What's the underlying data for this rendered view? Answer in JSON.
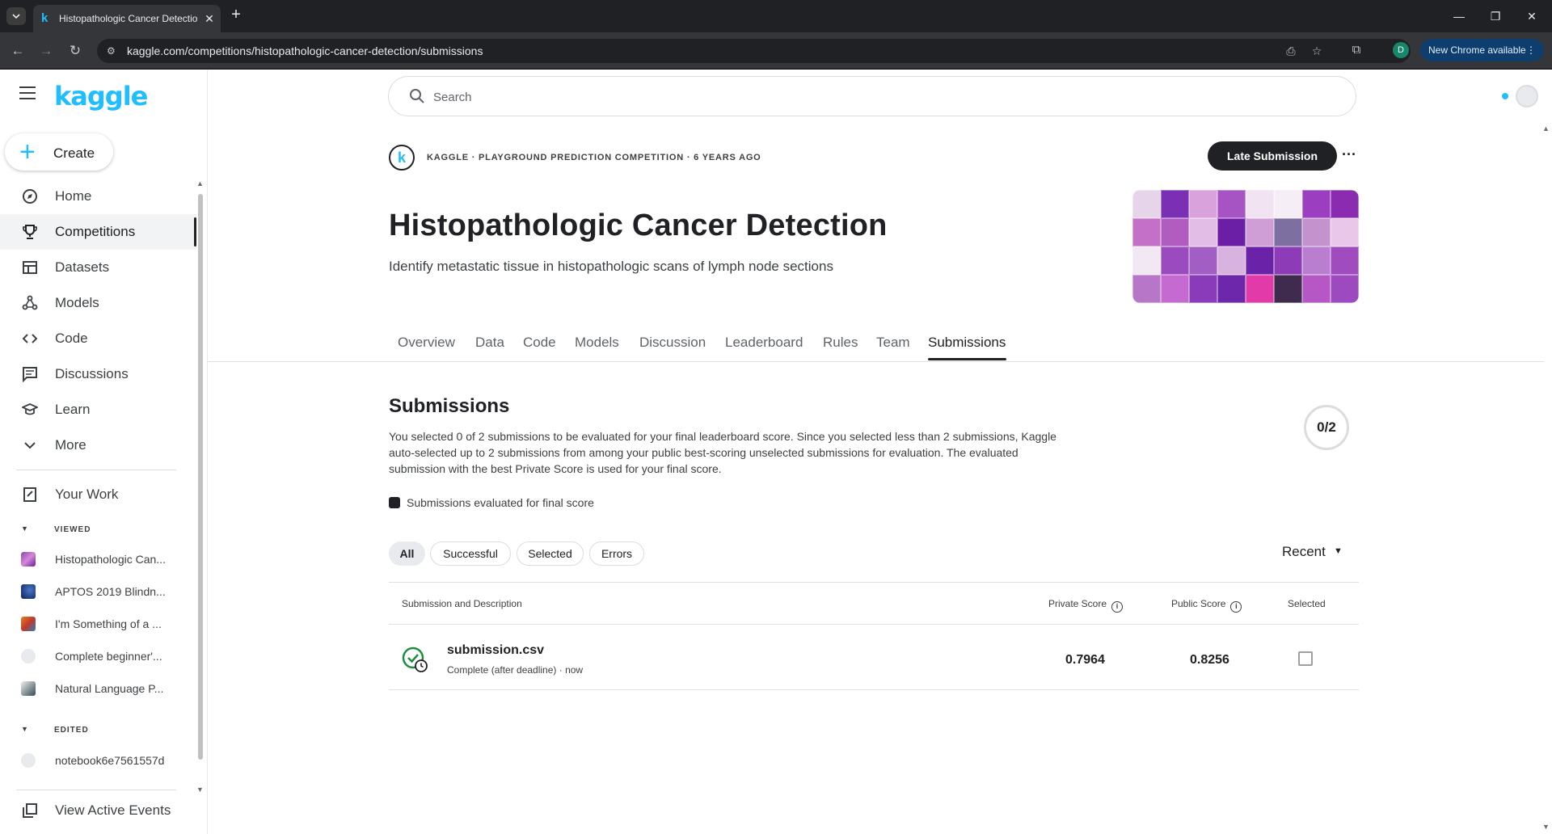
{
  "browser": {
    "tab_title": "Histopathologic Cancer Detection",
    "url": "kaggle.com/competitions/histopathologic-cancer-detection/submissions",
    "profile_initial": "D",
    "update_label": "New Chrome available"
  },
  "sidebar": {
    "logo": "kaggle",
    "create_label": "Create",
    "nav_items": [
      {
        "label": "Home",
        "icon": "compass-icon"
      },
      {
        "label": "Competitions",
        "icon": "trophy-icon"
      },
      {
        "label": "Datasets",
        "icon": "table-icon"
      },
      {
        "label": "Models",
        "icon": "models-icon"
      },
      {
        "label": "Code",
        "icon": "code-icon"
      },
      {
        "label": "Discussions",
        "icon": "discussion-icon"
      },
      {
        "label": "Learn",
        "icon": "graduation-cap-icon"
      },
      {
        "label": "More",
        "icon": "chevron-down-icon"
      }
    ],
    "your_work": "Your Work",
    "viewed_section": "VIEWED",
    "viewed_items": [
      "Histopathologic Can...",
      "APTOS 2019 Blindn...",
      "I'm Something of a ...",
      "Complete beginner'...",
      "Natural Language P..."
    ],
    "edited_section": "EDITED",
    "edited_items": [
      "notebook6e7561557d"
    ],
    "view_active_events": "View Active Events"
  },
  "search": {
    "placeholder": "Search"
  },
  "competition": {
    "meta": "KAGGLE · PLAYGROUND PREDICTION COMPETITION · 6 YEARS AGO",
    "late_submission_label": "Late Submission",
    "more_label": "···",
    "title": "Histopathologic Cancer Detection",
    "subtitle": "Identify metastatic tissue in histopathologic scans of lymph node sections",
    "tabs": [
      "Overview",
      "Data",
      "Code",
      "Models",
      "Discussion",
      "Leaderboard",
      "Rules",
      "Team",
      "Submissions"
    ],
    "active_tab": "Submissions"
  },
  "submissions": {
    "heading": "Submissions",
    "description": "You selected 0 of 2 submissions to be evaluated for your final leaderboard score. Since you selected less than 2 submissions, Kaggle auto-selected up to 2 submissions from among your public best-scoring unselected submissions for evaluation. The evaluated submission with the best Private Score is used for your final score.",
    "counter": "0/2",
    "legend": "Submissions evaluated for final score",
    "filters": [
      "All",
      "Successful",
      "Selected",
      "Errors"
    ],
    "active_filter": "All",
    "sort_label": "Recent",
    "columns": {
      "description": "Submission and Description",
      "private": "Private Score",
      "public": "Public Score",
      "selected": "Selected"
    },
    "rows": [
      {
        "file": "submission.csv",
        "status": "Complete (after deadline) · now",
        "private_score": "0.7964",
        "public_score": "0.8256",
        "selected": false
      }
    ]
  },
  "colors": {
    "kaggle_blue": "#20beff",
    "success_green": "#1e8e3e",
    "dark": "#202124"
  }
}
